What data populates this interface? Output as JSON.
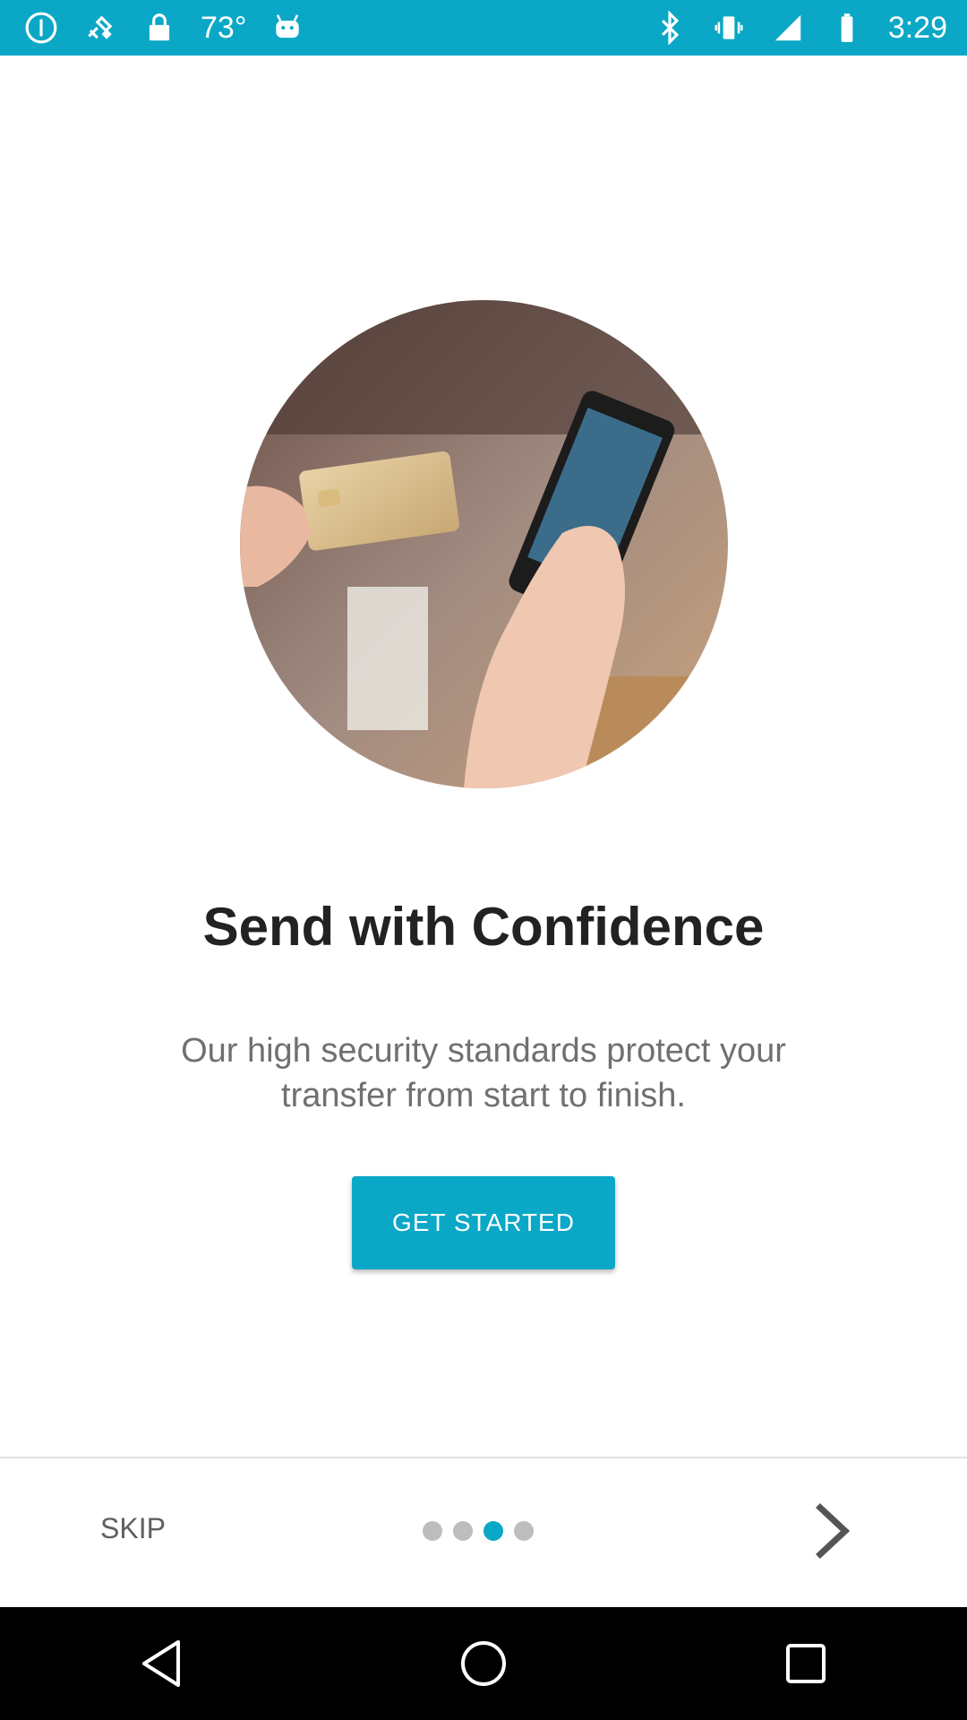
{
  "status_bar": {
    "temperature": "73°",
    "time": "3:29",
    "left_icons": [
      "info-icon",
      "satellite-icon",
      "lock-icon"
    ],
    "right_icons": [
      "bluetooth-icon",
      "vibrate-icon",
      "signal-icon",
      "battery-icon"
    ],
    "background": "#0aa7c7"
  },
  "onboarding": {
    "image_subject": "hands holding credit card and smartphone",
    "title": "Send with Confidence",
    "subtitle": "Our high security standards protect your transfer from start to finish.",
    "cta_label": "GET STARTED"
  },
  "bottom_bar": {
    "skip_label": "SKIP",
    "page_count": 4,
    "active_page": 3,
    "next_icon": "chevron-right-icon"
  },
  "nav_bar": {
    "buttons": [
      "back-icon",
      "home-icon",
      "recents-icon"
    ]
  },
  "colors": {
    "accent": "#0aa7c7",
    "title": "#222222",
    "subtitle": "#707070"
  }
}
